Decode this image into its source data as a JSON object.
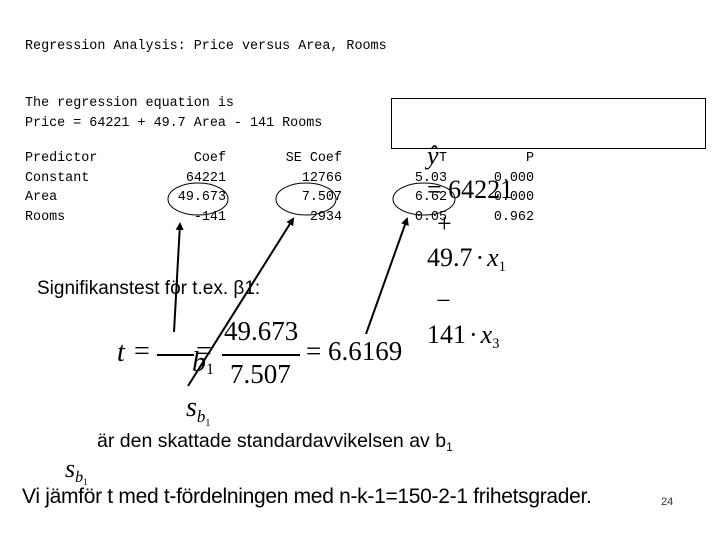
{
  "title": "Regression Analysis: Price versus Area, Rooms",
  "equation_intro": "The regression equation is",
  "equation_text": "Price = 64221 + 49.7 Area - 141 Rooms",
  "equation_box": {
    "yhat": "ŷ",
    "eq": "= 64221",
    "plus": "+",
    "coef1": "49.7",
    "dot": "·",
    "x1": "x",
    "x1_sub": "1",
    "minus": "−",
    "coef3": "141",
    "x3": "x",
    "x3_sub": "3"
  },
  "table": {
    "headers": [
      "Predictor",
      "Coef",
      "SE Coef",
      "T",
      "P"
    ],
    "rows": [
      [
        "Constant",
        "64221",
        "12766",
        "5.03",
        "0.000"
      ],
      [
        "Area",
        "49.673",
        "7.507",
        "6.62",
        "0.000"
      ],
      [
        "Rooms",
        "-141",
        "2934",
        "0.05",
        "0.962"
      ]
    ],
    "highlighted_row": "Area"
  },
  "significance_heading": "Signifikanstest för t.ex. β1:",
  "t_formula": {
    "t": "t",
    "equals": "=",
    "num_symbol": "b",
    "num_sub": "1",
    "den_symbol": "s",
    "den_sub_symbol": "b",
    "den_sub_sub": "1",
    "num_value": "49.673",
    "den_value": "7.507",
    "result": "= 6.6169"
  },
  "sb1_explanation": {
    "symbol": "s",
    "sub_symbol": "b",
    "sub_sub": "1",
    "text": "är den skattade standardavvikelsen av b",
    "text_sub": "1"
  },
  "conclusion": "Vi jämför t med t-fördelningen med n-k-1=150-2-1 frihetsgrader.",
  "slide_number": "24"
}
